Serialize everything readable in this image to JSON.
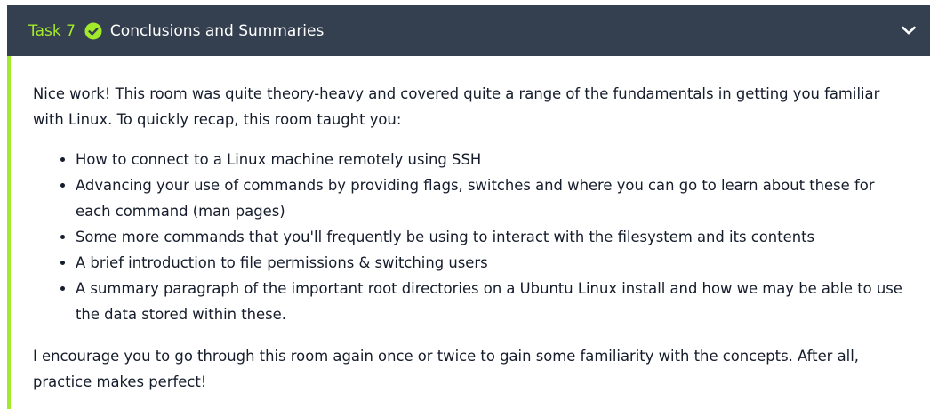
{
  "task": {
    "number": "Task 7",
    "title": "Conclusions and Summaries",
    "status_icon": "check-circle-icon",
    "toggle_icon": "chevron-down-icon",
    "accent_color": "#a3ea2a",
    "header_color": "#343f4f"
  },
  "content": {
    "intro": "Nice work! This room was quite theory-heavy and covered quite a range of the fundamentals in getting you familiar with Linux. To quickly recap, this room taught you:",
    "bullets": [
      "How to connect to a Linux machine remotely using SSH",
      "Advancing your use of commands by providing flags, switches and where you can go to learn about these for each command (man pages)",
      "Some more commands that you'll frequently be using to interact with the filesystem and its contents",
      "A brief introduction to file permissions & switching users",
      "A summary paragraph of the important root directories on a Ubuntu Linux install and how we may be able to use the data stored within these."
    ],
    "outro": "I encourage you to go through this room again once or twice to gain some familiarity with the concepts. After all, practice makes perfect!"
  }
}
